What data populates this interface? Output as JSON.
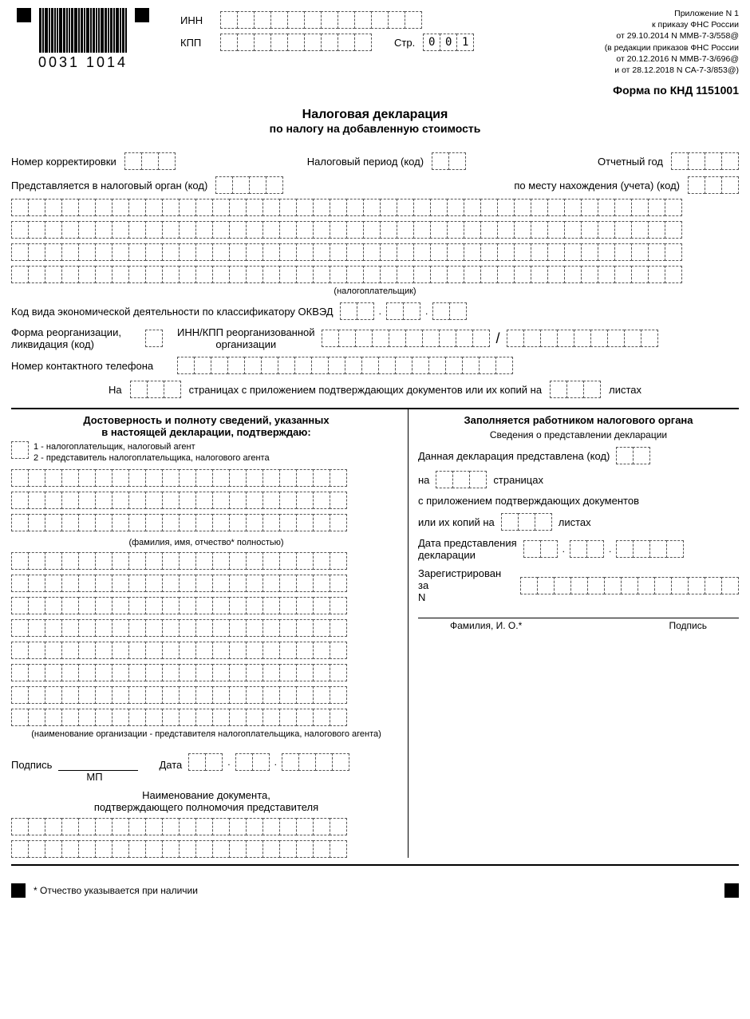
{
  "barcode_number": "0031  1014",
  "labels": {
    "inn": "ИНН",
    "kpp": "КПП",
    "page": "Стр.",
    "page_value": [
      "0",
      "0",
      "1"
    ],
    "annex": [
      "Приложение N 1",
      "к приказу ФНС России",
      "от 29.10.2014 N ММВ-7-3/558@",
      "(в редакции приказов ФНС России",
      "от 20.12.2016 N ММВ-7-3/696@",
      "и от 28.12.2018 N СА-7-3/853@)"
    ],
    "form_code": "Форма по КНД 1151001",
    "title1": "Налоговая декларация",
    "title2": "по налогу на добавленную стоимость",
    "corr_num": "Номер корректировки",
    "tax_period": "Налоговый период (код)",
    "report_year": "Отчетный год",
    "submitted_to": "Представляется в налоговый орган (код)",
    "by_location": "по месту нахождения (учета) (код)",
    "taxpayer": "(налогоплательщик)",
    "okved": "Код вида экономической деятельности по классификатору ОКВЭД",
    "reorg_form": "Форма реорганизации,\nликвидация (код)",
    "reorg_inn_kpp": "ИНН/КПП реорганизованной\nорганизации",
    "contact_phone": "Номер контактного телефона",
    "on": "На",
    "pages_attach": "страницах с приложением подтверждающих документов или их копий на",
    "sheets": "листах",
    "left_head": "Достоверность и полноту сведений, указанных\nв настоящей декларации, подтверждаю:",
    "type1": "1 - налогоплательщик, налоговый агент",
    "type2": "2 - представитель налогоплательщика, налогового агента",
    "fio_note": "(фамилия, имя, отчество* полностью)",
    "org_note": "(наименование организации - представителя налогоплательщика, налогового агента)",
    "signature": "Подпись",
    "mp": "МП",
    "date": "Дата",
    "doc_name": "Наименование документа,",
    "doc_auth": "подтверждающего полномочия представителя",
    "right_head": "Заполняется работником налогового органа",
    "right_sub": "Сведения о представлении декларации",
    "decl_submitted": "Данная декларация представлена (код)",
    "on2": "на",
    "pages2": "страницах",
    "attach2": "с приложением подтверждающих документов",
    "copies_on": "или их копий на",
    "sheets2": "листах",
    "submit_date": "Дата представления\nдекларации",
    "reg_n": "Зарегистрирован за\nN",
    "fio": "Фамилия, И. О.*",
    "sig2": "Подпись",
    "footnote": "* Отчество указывается при наличии"
  }
}
